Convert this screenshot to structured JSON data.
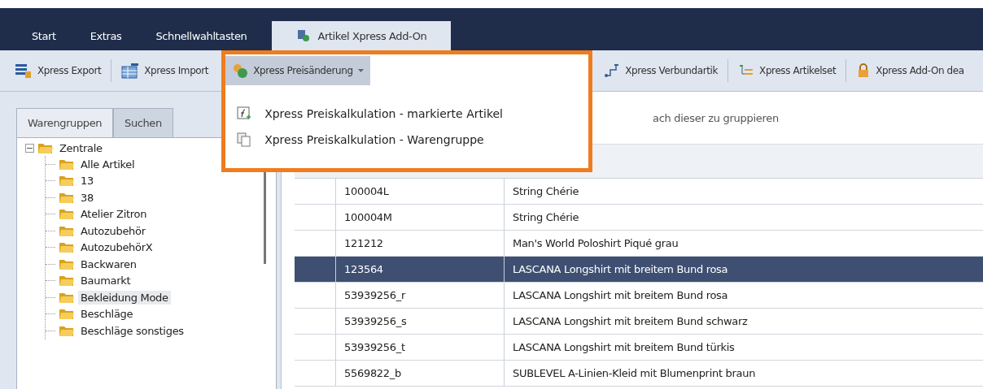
{
  "ribbon_tabs": [
    {
      "label": "Start",
      "selected": false
    },
    {
      "label": "Extras",
      "selected": false
    },
    {
      "label": "Schnellwahltasten",
      "selected": false
    },
    {
      "label": "Artikel Xpress Add-On",
      "selected": true
    }
  ],
  "toolbar": [
    {
      "label": "Xpress Export",
      "kind": "export",
      "dropdown": false,
      "open": false
    },
    {
      "label": "Xpress Import",
      "kind": "import",
      "dropdown": false,
      "open": false
    },
    {
      "label": "Xpress Preisänderung",
      "kind": "price",
      "dropdown": true,
      "open": true
    },
    {
      "label": "Xpress Verbundartik",
      "kind": "link",
      "dropdown": false,
      "open": false
    },
    {
      "label": "Xpress Artikelset",
      "kind": "set",
      "dropdown": false,
      "open": false
    },
    {
      "label": "Xpress Add-On dea",
      "kind": "lock",
      "dropdown": false,
      "open": false
    }
  ],
  "dropdown_menu": [
    {
      "label": "Xpress Preiskalkulation - markierte Artikel",
      "kind": "formula"
    },
    {
      "label": "Xpress Preiskalkulation - Warengruppe",
      "kind": "group"
    }
  ],
  "side_tabs": [
    {
      "label": "Warengruppen",
      "selected": true
    },
    {
      "label": "Suchen",
      "selected": false
    }
  ],
  "tree": [
    {
      "label": "Zentrale",
      "expanded": true,
      "selected": false,
      "children": [
        {
          "label": "Alle Artikel",
          "selected": false
        },
        {
          "label": "13",
          "selected": false
        },
        {
          "label": "38",
          "selected": false
        },
        {
          "label": "Atelier Zitron",
          "selected": false
        },
        {
          "label": "Autozubehör",
          "selected": false
        },
        {
          "label": "AutozubehörX",
          "selected": false
        },
        {
          "label": "Backwaren",
          "selected": false
        },
        {
          "label": "Baumarkt",
          "selected": false
        },
        {
          "label": "Bekleidung Mode",
          "selected": true
        },
        {
          "label": "Beschläge",
          "selected": false
        },
        {
          "label": "Beschläge sonstiges",
          "selected": false
        }
      ]
    }
  ],
  "group_panel_hint": "ach dieser zu gruppieren",
  "table": {
    "rows": [
      {
        "cells": [
          "100004L",
          "String Chérie"
        ],
        "selected": false
      },
      {
        "cells": [
          "100004M",
          "String Chérie"
        ],
        "selected": false
      },
      {
        "cells": [
          "121212",
          "Man's World Poloshirt Piqué grau"
        ],
        "selected": false
      },
      {
        "cells": [
          "123564",
          "LASCANA Longshirt mit breitem Bund rosa"
        ],
        "selected": true
      },
      {
        "cells": [
          "53939256_r",
          "LASCANA Longshirt mit breitem Bund rosa"
        ],
        "selected": false
      },
      {
        "cells": [
          "53939256_s",
          "LASCANA Longshirt mit breitem Bund schwarz"
        ],
        "selected": false
      },
      {
        "cells": [
          "53939256_t",
          "LASCANA Longshirt mit breitem Bund türkis"
        ],
        "selected": false
      },
      {
        "cells": [
          "5569822_b",
          "SUBLEVEL A-Linien-Kleid mit Blumenprint braun"
        ],
        "selected": false
      }
    ]
  }
}
